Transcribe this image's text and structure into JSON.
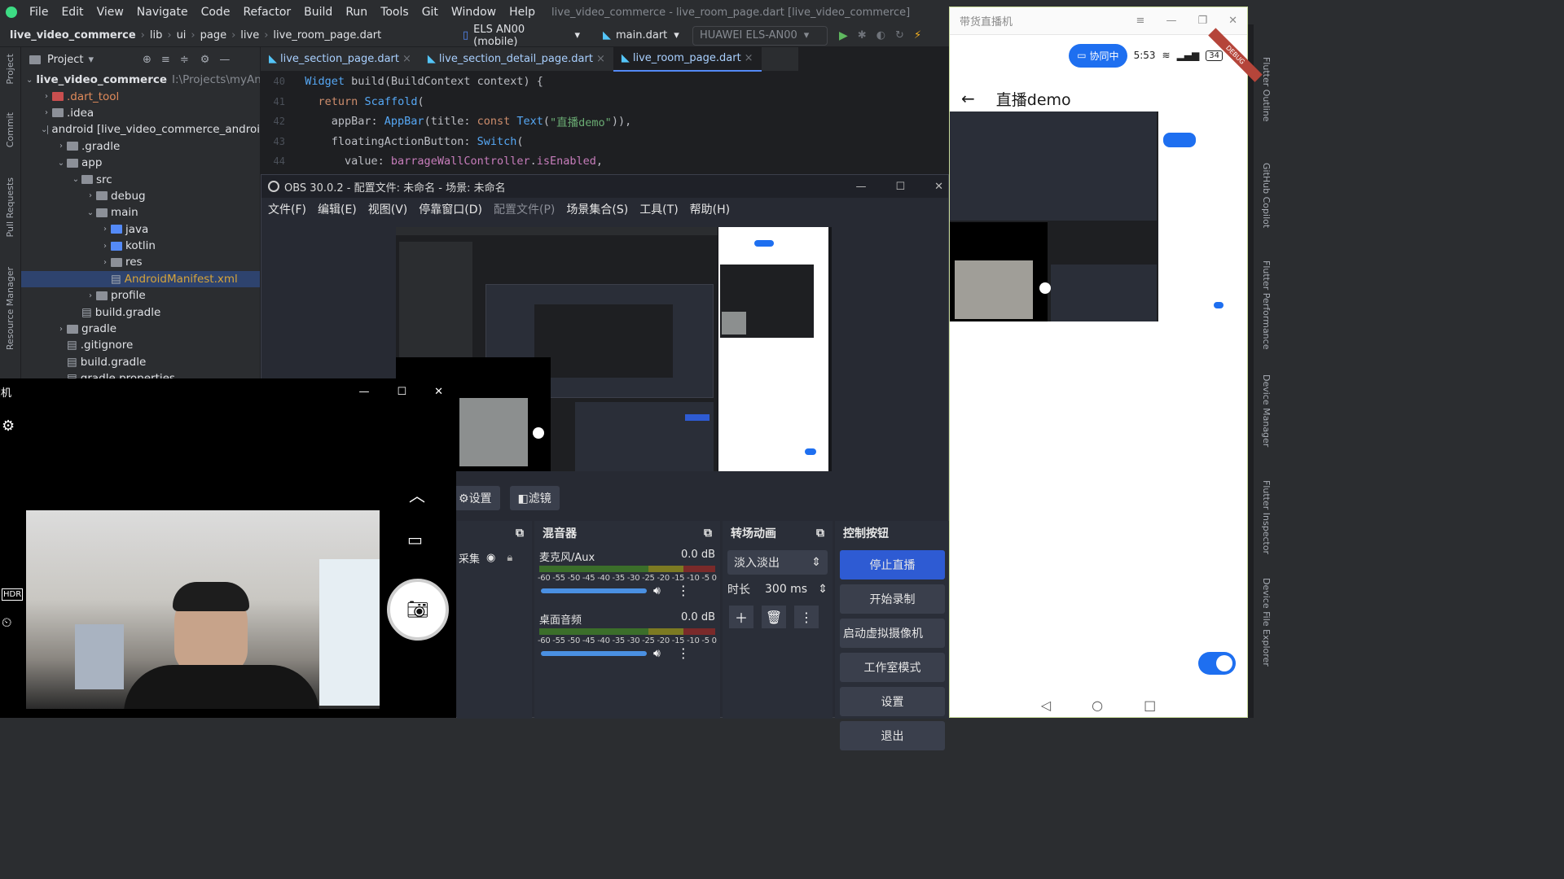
{
  "ide": {
    "menu": [
      "File",
      "Edit",
      "View",
      "Navigate",
      "Code",
      "Refactor",
      "Build",
      "Run",
      "Tools",
      "Git",
      "Window",
      "Help"
    ],
    "window_title": "live_video_commerce - live_room_page.dart [live_video_commerce]",
    "breadcrumb": [
      "live_video_commerce",
      "lib",
      "ui",
      "page",
      "live",
      "live_room_page.dart"
    ],
    "device": "ELS AN00 (mobile)",
    "run_config": "main.dart",
    "target_device": "HUAWEI ELS-AN00",
    "left_tools": [
      "Project",
      "Commit",
      "Pull Requests",
      "Resource Manager"
    ],
    "right_tools": [
      "Flutter Outline",
      "GitHub Copilot",
      "Flutter Performance",
      "Device Manager",
      "Flutter Inspector",
      "Device File Explorer"
    ],
    "project_header": "Project",
    "tree": [
      {
        "label": "live_video_commerce",
        "suffix": "I:\\Projects\\myAndr",
        "indent": 0,
        "arrow": "down",
        "icon": "folder"
      },
      {
        "label": ".dart_tool",
        "indent": 1,
        "arrow": "right",
        "icon": "folder-red"
      },
      {
        "label": ".idea",
        "indent": 1,
        "arrow": "right",
        "icon": "folder"
      },
      {
        "label": "android [live_video_commerce_androi",
        "indent": 1,
        "arrow": "down",
        "icon": "folder"
      },
      {
        "label": ".gradle",
        "indent": 2,
        "arrow": "right",
        "icon": "folder"
      },
      {
        "label": "app",
        "indent": 2,
        "arrow": "down",
        "icon": "folder"
      },
      {
        "label": "src",
        "indent": 3,
        "arrow": "down",
        "icon": "folder"
      },
      {
        "label": "debug",
        "indent": 4,
        "arrow": "right",
        "icon": "folder"
      },
      {
        "label": "main",
        "indent": 4,
        "arrow": "down",
        "icon": "folder"
      },
      {
        "label": "java",
        "indent": 5,
        "arrow": "right",
        "icon": "folder-blue"
      },
      {
        "label": "kotlin",
        "indent": 5,
        "arrow": "right",
        "icon": "folder-blue"
      },
      {
        "label": "res",
        "indent": 5,
        "arrow": "right",
        "icon": "folder"
      },
      {
        "label": "AndroidManifest.xml",
        "indent": 5,
        "arrow": "",
        "icon": "file",
        "selected": true
      },
      {
        "label": "profile",
        "indent": 4,
        "arrow": "right",
        "icon": "folder"
      },
      {
        "label": "build.gradle",
        "indent": 3,
        "arrow": "",
        "icon": "file"
      },
      {
        "label": "gradle",
        "indent": 2,
        "arrow": "right",
        "icon": "folder"
      },
      {
        "label": ".gitignore",
        "indent": 2,
        "arrow": "",
        "icon": "file"
      },
      {
        "label": "build.gradle",
        "indent": 2,
        "arrow": "",
        "icon": "file"
      },
      {
        "label": "gradle.properties",
        "indent": 2,
        "arrow": "",
        "icon": "file"
      }
    ],
    "tabs": [
      "live_section_page.dart",
      "live_section_detail_page.dart",
      "live_room_page.dart"
    ],
    "code": [
      {
        "n": "40",
        "parts": [
          [
            "pl",
            "  "
          ],
          [
            "ty",
            "Widget"
          ],
          [
            "pl",
            " build(BuildContext context) {"
          ]
        ]
      },
      {
        "n": "41",
        "parts": [
          [
            "pl",
            "    "
          ],
          [
            "kw",
            "return"
          ],
          [
            "pl",
            " "
          ],
          [
            "fn",
            "Scaffold"
          ],
          [
            "pl",
            "("
          ]
        ]
      },
      {
        "n": "42",
        "parts": [
          [
            "pl",
            "      appBar: "
          ],
          [
            "fn",
            "AppBar"
          ],
          [
            "pl",
            "(title: "
          ],
          [
            "kw",
            "const"
          ],
          [
            "pl",
            " "
          ],
          [
            "fn",
            "Text"
          ],
          [
            "pl",
            "("
          ],
          [
            "st",
            "\"直播demo\""
          ],
          [
            "pl",
            ")),"
          ]
        ]
      },
      {
        "n": "43",
        "parts": [
          [
            "pl",
            "      floatingActionButton: "
          ],
          [
            "fn",
            "Switch"
          ],
          [
            "pl",
            "("
          ]
        ]
      },
      {
        "n": "44",
        "parts": [
          [
            "pl",
            "        value: "
          ],
          [
            "ac",
            "barrageWallController"
          ],
          [
            "pl",
            "."
          ],
          [
            "ac",
            "isEnabled"
          ],
          [
            "pl",
            ","
          ]
        ]
      }
    ]
  },
  "obs": {
    "title": "OBS 30.0.2 - 配置文件: 未命名 - 场景: 未命名",
    "menu": [
      "文件(F)",
      "编辑(E)",
      "视图(V)",
      "停靠窗口(D)",
      "配置文件(P)",
      "场景集合(S)",
      "工具(T)",
      "帮助(H)"
    ],
    "source_toolbar": [
      "设置",
      "滤镜"
    ],
    "source_item": "采集",
    "mixer": {
      "title": "混音器",
      "tracks": [
        {
          "name": "麦克风/Aux",
          "db": "0.0 dB"
        },
        {
          "name": "桌面音频",
          "db": "0.0 dB"
        }
      ],
      "ticks": "-60 -55 -50 -45 -40 -35 -30 -25 -20 -15 -10 -5  0"
    },
    "transition": {
      "title": "转场动画",
      "type": "淡入淡出",
      "duration_label": "时长",
      "duration": "300 ms"
    },
    "controls": {
      "title": "控制按钮",
      "buttons": [
        "停止直播",
        "开始录制",
        "启动虚拟摄像机",
        "工作室模式",
        "设置",
        "退出"
      ]
    }
  },
  "camera": {
    "title": "相机"
  },
  "phone": {
    "window_title": "带货直播机",
    "status_pill": "协同中",
    "time": "5:53",
    "battery": "34",
    "debug": "DEBUG",
    "appbar_title": "直播demo",
    "switch_on": true
  }
}
